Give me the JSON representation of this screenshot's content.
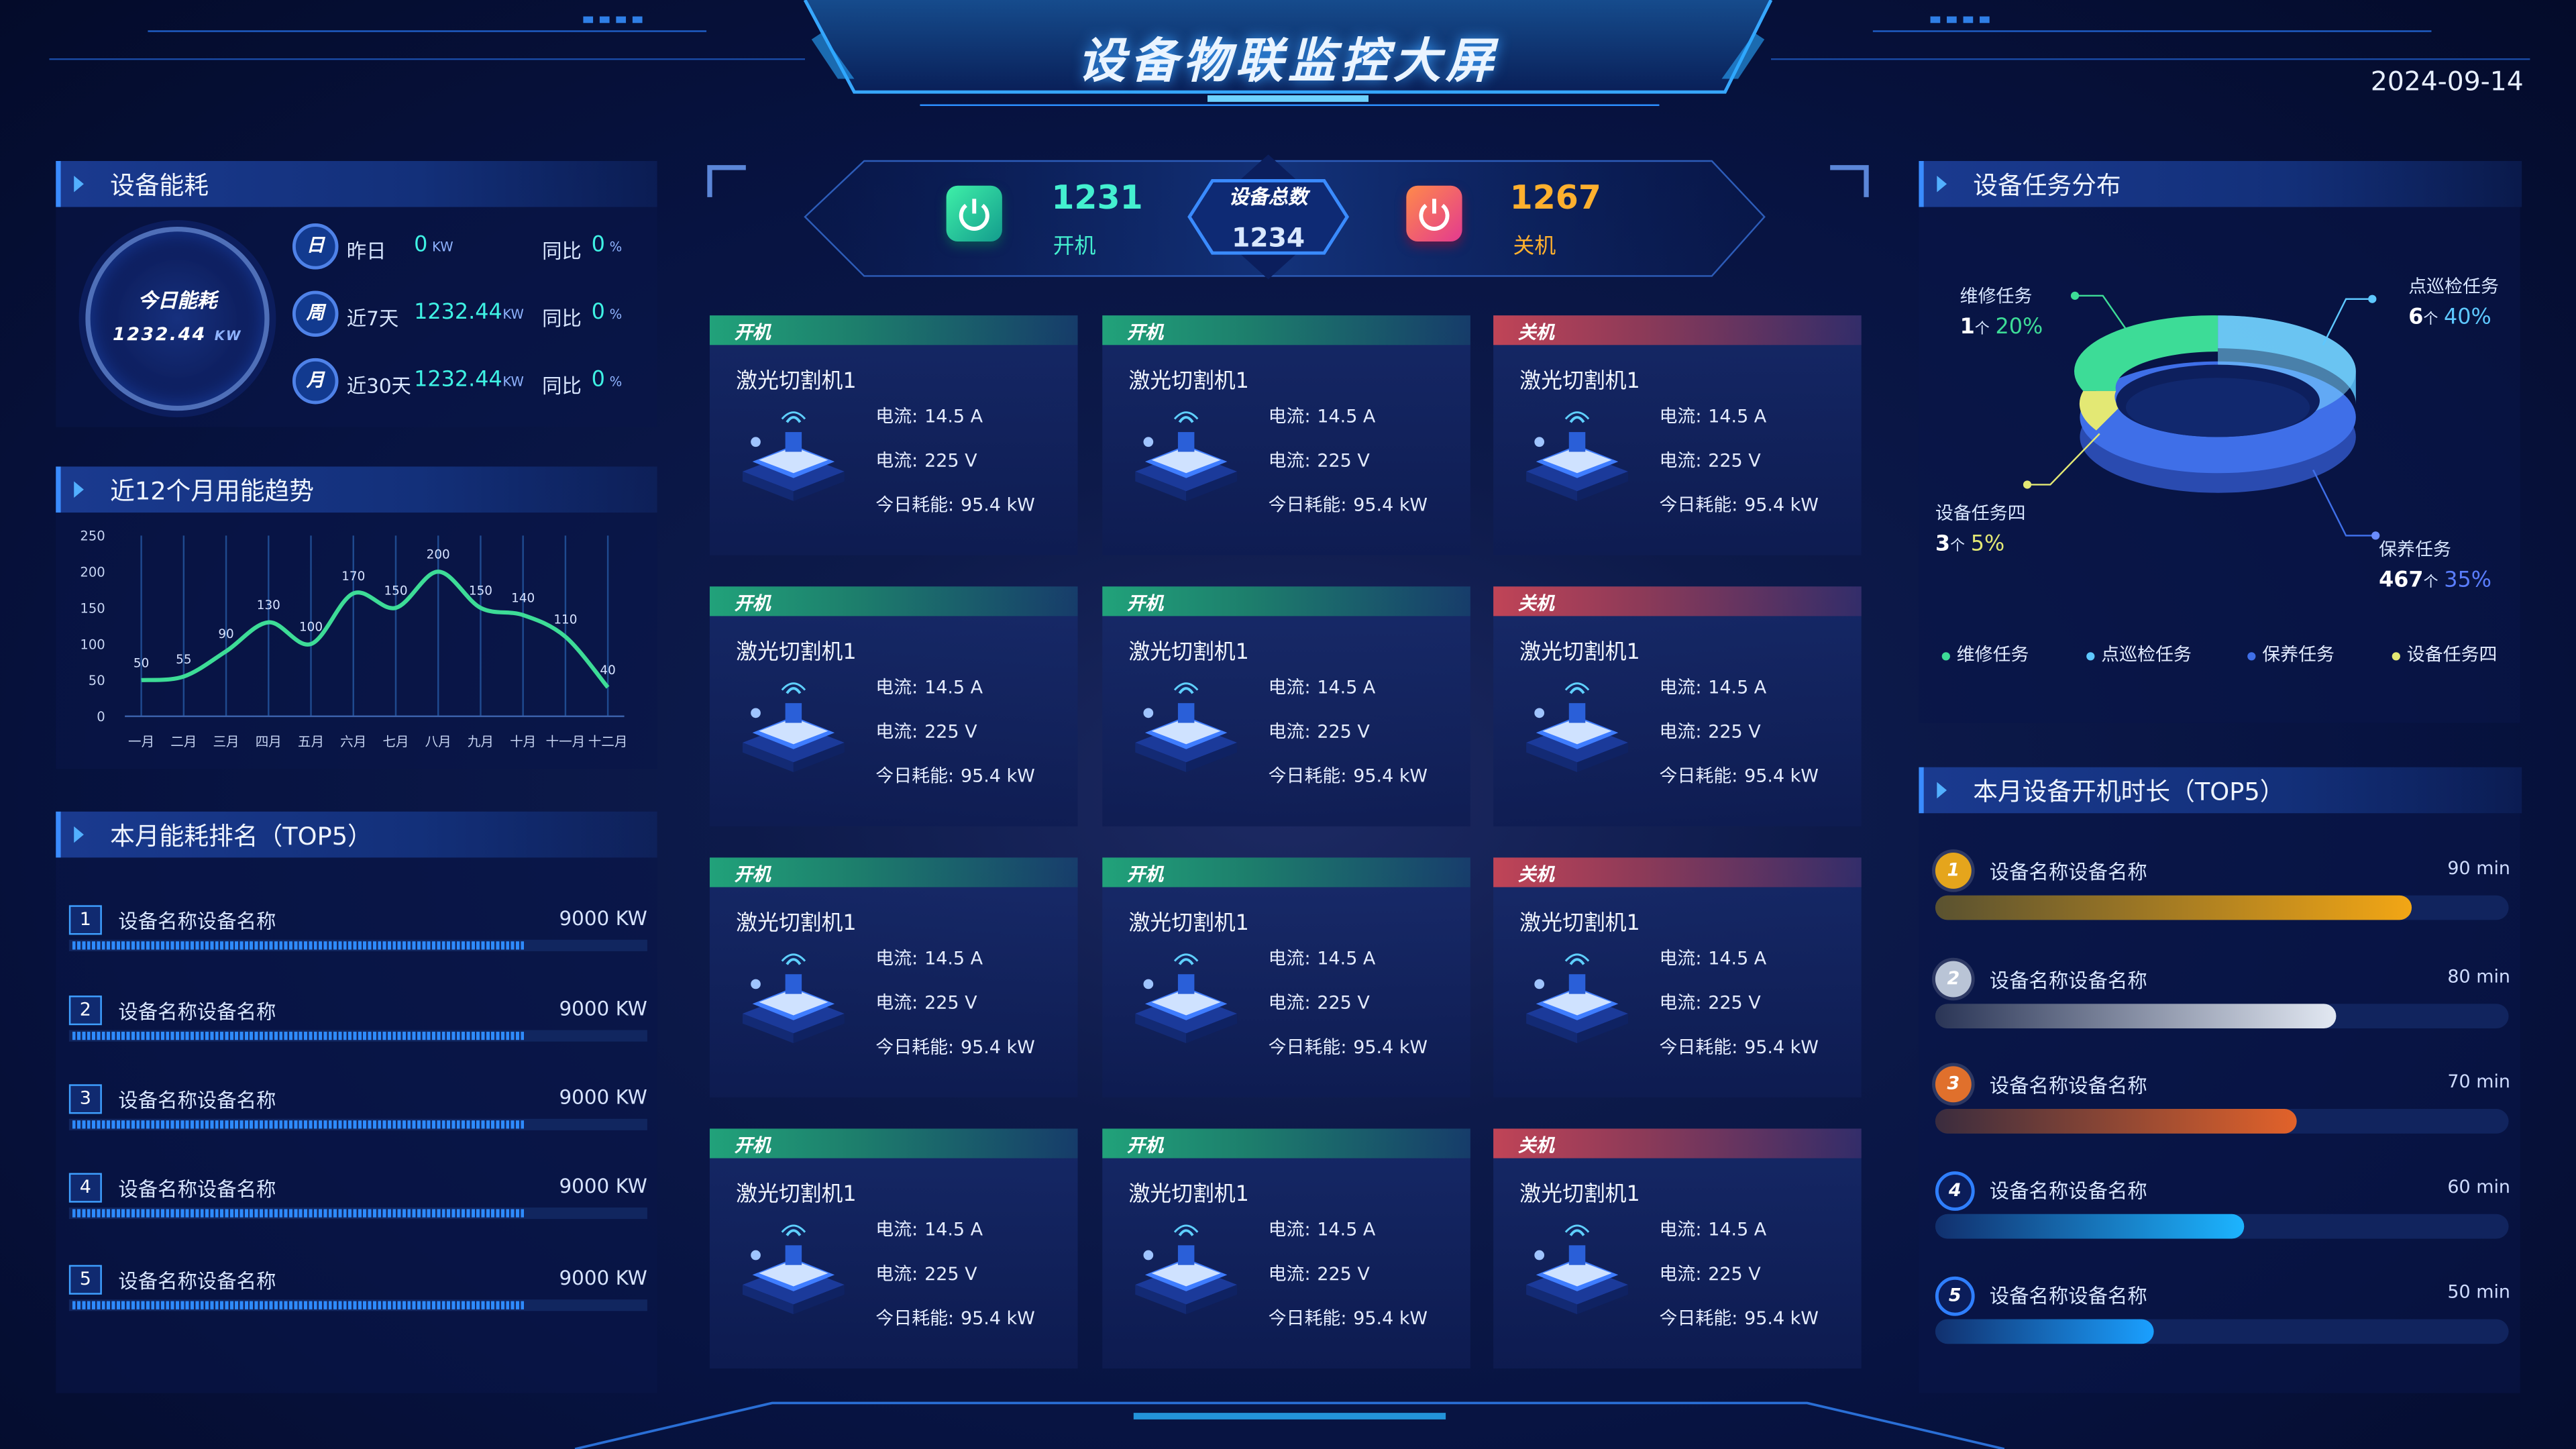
{
  "header": {
    "title": "设备物联监控大屏",
    "date": "2024-09-14"
  },
  "energy": {
    "title": "设备能耗",
    "today_label": "今日能耗",
    "today_value": "1232.44",
    "today_unit": "KW",
    "rows": [
      {
        "badge": "日",
        "label": "昨日",
        "value": "0",
        "unit": "KW",
        "yoy_label": "同比",
        "yoy": "0",
        "pct": "%"
      },
      {
        "badge": "周",
        "label": "近7天",
        "value": "1232.44",
        "unit": "KW",
        "yoy_label": "同比",
        "yoy": "0",
        "pct": "%"
      },
      {
        "badge": "月",
        "label": "近30天",
        "value": "1232.44",
        "unit": "KW",
        "yoy_label": "同比",
        "yoy": "0",
        "pct": "%"
      }
    ]
  },
  "trend": {
    "title": "近12个月用能趋势"
  },
  "chart_data": {
    "type": "line",
    "categories": [
      "一月",
      "二月",
      "三月",
      "四月",
      "五月",
      "六月",
      "七月",
      "八月",
      "九月",
      "十月",
      "十一月",
      "十二月"
    ],
    "values": [
      50,
      55,
      90,
      130,
      100,
      170,
      150,
      200,
      150,
      140,
      110,
      40
    ],
    "y_ticks": [
      "0",
      "50",
      "100",
      "150",
      "200",
      "250"
    ],
    "ylim": [
      0,
      250
    ],
    "title": "",
    "xlabel": "",
    "ylabel": "",
    "grid": "vertical",
    "color": "#3ddc97"
  },
  "rank": {
    "title": "本月能耗排名（TOP5）",
    "items": [
      {
        "num": "1",
        "name": "设备名称设备名称",
        "value": "9000 KW",
        "ratio": 0.78
      },
      {
        "num": "2",
        "name": "设备名称设备名称",
        "value": "9000 KW",
        "ratio": 0.78
      },
      {
        "num": "3",
        "name": "设备名称设备名称",
        "value": "9000 KW",
        "ratio": 0.78
      },
      {
        "num": "4",
        "name": "设备名称设备名称",
        "value": "9000 KW",
        "ratio": 0.78
      },
      {
        "num": "5",
        "name": "设备名称设备名称",
        "value": "9000 KW",
        "ratio": 0.78
      }
    ]
  },
  "summary": {
    "on_count": "1231",
    "on_label": "开机",
    "total_label": "设备总数",
    "total_count": "1234",
    "off_count": "1267",
    "off_label": "关机"
  },
  "devices": {
    "current_label": "电流:",
    "voltage_label": "电流:",
    "energy_label": "今日耗能:",
    "items": [
      {
        "status": "开机",
        "state": "on",
        "name": "激光切割机1",
        "current": "14.5 A",
        "voltage": "225 V",
        "energy": "95.4 kW"
      },
      {
        "status": "开机",
        "state": "on",
        "name": "激光切割机1",
        "current": "14.5 A",
        "voltage": "225 V",
        "energy": "95.4 kW"
      },
      {
        "status": "关机",
        "state": "off",
        "name": "激光切割机1",
        "current": "14.5 A",
        "voltage": "225 V",
        "energy": "95.4 kW"
      },
      {
        "status": "开机",
        "state": "on",
        "name": "激光切割机1",
        "current": "14.5 A",
        "voltage": "225 V",
        "energy": "95.4 kW"
      },
      {
        "status": "开机",
        "state": "on",
        "name": "激光切割机1",
        "current": "14.5 A",
        "voltage": "225 V",
        "energy": "95.4 kW"
      },
      {
        "status": "关机",
        "state": "off",
        "name": "激光切割机1",
        "current": "14.5 A",
        "voltage": "225 V",
        "energy": "95.4 kW"
      },
      {
        "status": "开机",
        "state": "on",
        "name": "激光切割机1",
        "current": "14.5 A",
        "voltage": "225 V",
        "energy": "95.4 kW"
      },
      {
        "status": "开机",
        "state": "on",
        "name": "激光切割机1",
        "current": "14.5 A",
        "voltage": "225 V",
        "energy": "95.4 kW"
      },
      {
        "status": "关机",
        "state": "off",
        "name": "激光切割机1",
        "current": "14.5 A",
        "voltage": "225 V",
        "energy": "95.4 kW"
      },
      {
        "status": "开机",
        "state": "on",
        "name": "激光切割机1",
        "current": "14.5 A",
        "voltage": "225 V",
        "energy": "95.4 kW"
      },
      {
        "status": "开机",
        "state": "on",
        "name": "激光切割机1",
        "current": "14.5 A",
        "voltage": "225 V",
        "energy": "95.4 kW"
      },
      {
        "status": "关机",
        "state": "off",
        "name": "激光切割机1",
        "current": "14.5 A",
        "voltage": "225 V",
        "energy": "95.4 kW"
      }
    ]
  },
  "task_dist": {
    "title": "设备任务分布",
    "slices": [
      {
        "name": "维修任务",
        "count": "1",
        "unit": "个",
        "pct": "20%",
        "color": "#3ddc97"
      },
      {
        "name": "点巡检任务",
        "count": "6",
        "unit": "个",
        "pct": "40%",
        "color": "#5ec8ff"
      },
      {
        "name": "保养任务",
        "count": "467",
        "unit": "个",
        "pct": "35%",
        "color": "#3f6fe8"
      },
      {
        "name": "设备任务四",
        "count": "3",
        "unit": "个",
        "pct": "5%",
        "color": "#e3e874"
      }
    ]
  },
  "runtime": {
    "title": "本月设备开机时长（TOP5）",
    "items": [
      {
        "rank": "1",
        "name": "设备名称设备名称",
        "value": "90 min",
        "ratio": 0.83,
        "color_a": "#5a5230",
        "color_b": "#f2a615",
        "medal": "#e5a51c"
      },
      {
        "rank": "2",
        "name": "设备名称设备名称",
        "value": "80 min",
        "ratio": 0.7,
        "color_a": "#2a3556",
        "color_b": "#e2e8f2",
        "medal": "#b9c4d6"
      },
      {
        "rank": "3",
        "name": "设备名称设备名称",
        "value": "70 min",
        "ratio": 0.63,
        "color_a": "#3a2c3e",
        "color_b": "#e2622a",
        "medal": "#e0702c"
      },
      {
        "rank": "4",
        "name": "设备名称设备名称",
        "value": "60 min",
        "ratio": 0.54,
        "color_a": "#11306e",
        "color_b": "#1cb4ff",
        "medal": "#163b8f"
      },
      {
        "rank": "5",
        "name": "设备名称设备名称",
        "value": "50 min",
        "ratio": 0.38,
        "color_a": "#11306e",
        "color_b": "#1aa0ff",
        "medal": "#163b8f"
      }
    ]
  }
}
